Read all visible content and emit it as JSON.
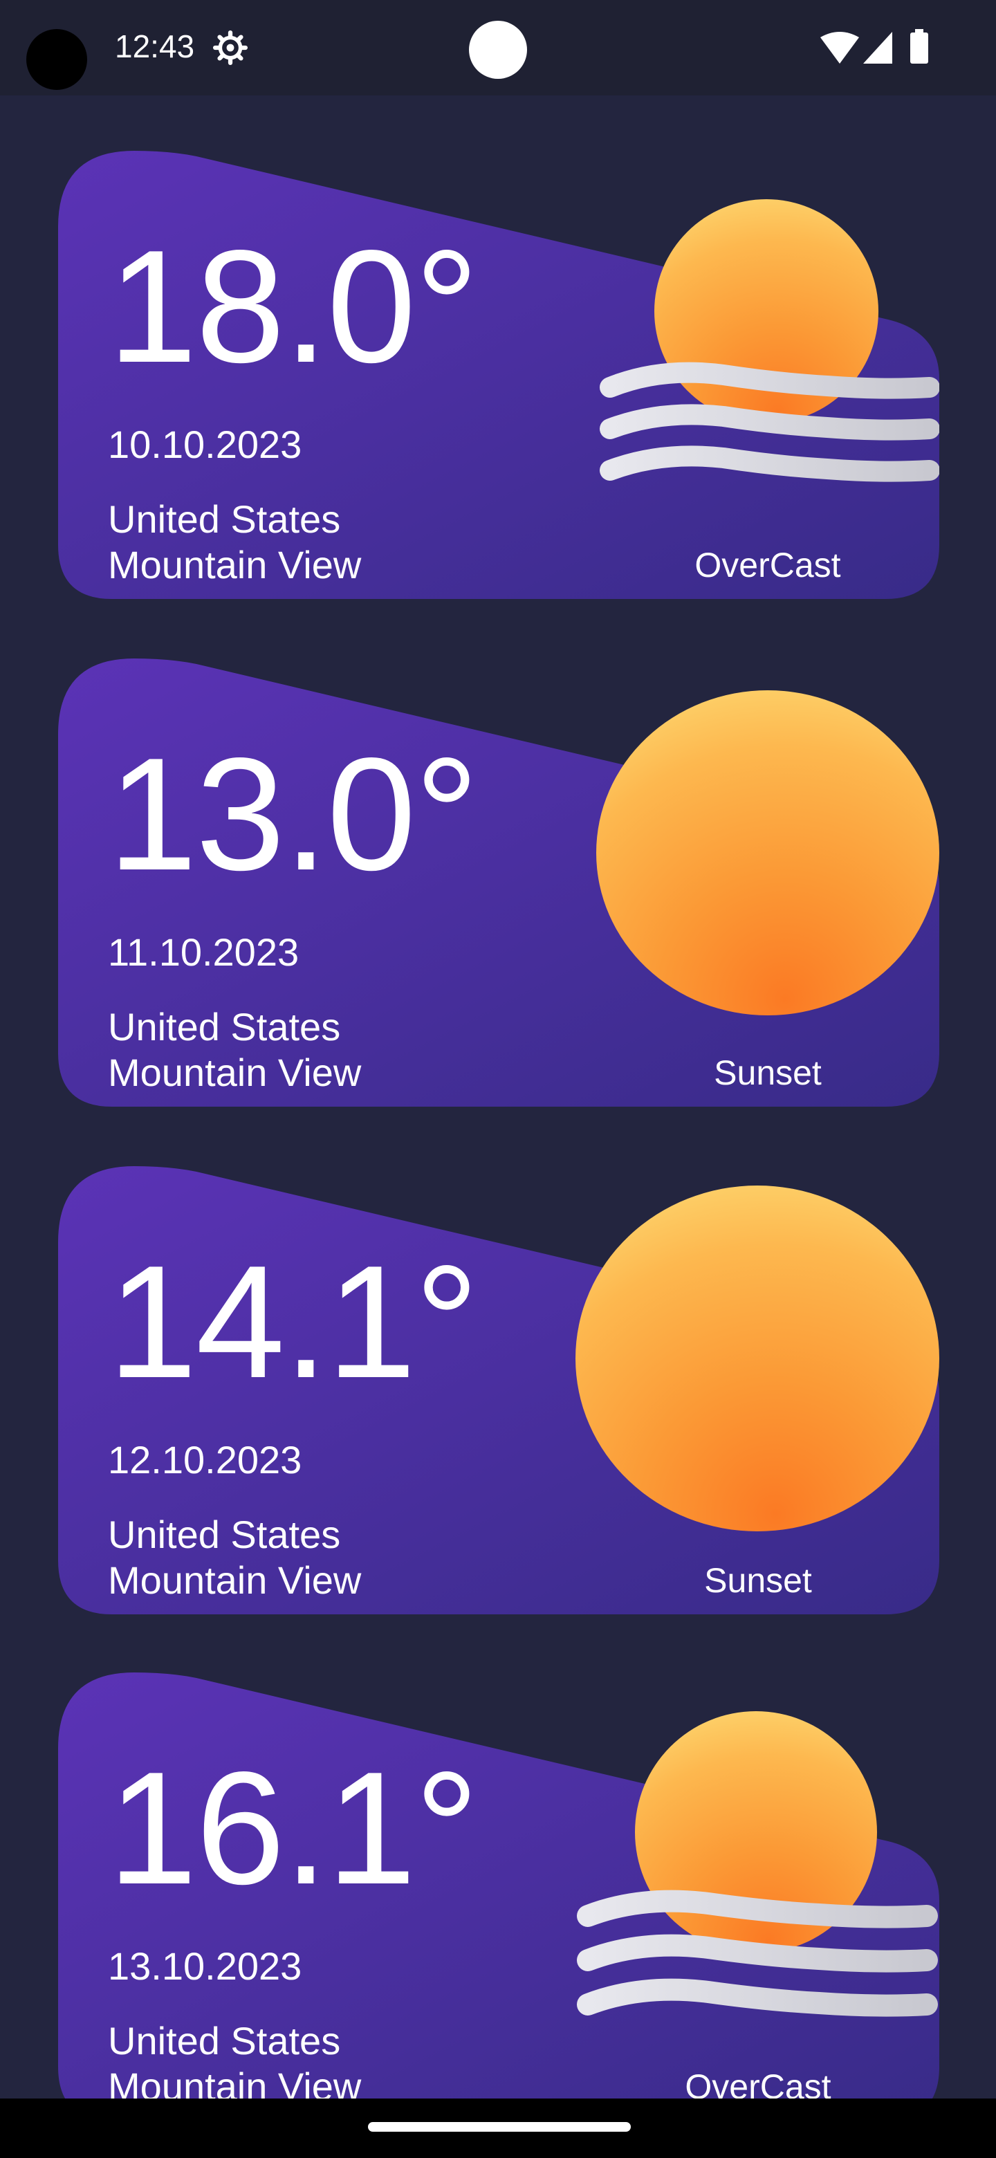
{
  "status_bar": {
    "time": "12:43",
    "icons": [
      "settings-icon",
      "wifi-icon",
      "cellular-icon",
      "battery-icon"
    ]
  },
  "colors": {
    "background": "#23253f",
    "card_gradient_start": "#5a32b4",
    "card_gradient_end": "#3a2c8c",
    "sun_core": "#fb7a24",
    "sun_edge": "#fde07a"
  },
  "forecasts": [
    {
      "temperature": "18.0°",
      "date": "10.10.2023",
      "country": "United States",
      "city": "Mountain View",
      "condition": "OverCast",
      "icon": "overcast-sun-icon"
    },
    {
      "temperature": "13.0°",
      "date": "11.10.2023",
      "country": "United States",
      "city": "Mountain View",
      "condition": "Sunset",
      "icon": "sun-icon"
    },
    {
      "temperature": "14.1°",
      "date": "12.10.2023",
      "country": "United States",
      "city": "Mountain View",
      "condition": "Sunset",
      "icon": "sun-icon"
    },
    {
      "temperature": "16.1°",
      "date": "13.10.2023",
      "country": "United States",
      "city": "Mountain View",
      "condition": "OverCast",
      "icon": "overcast-sun-icon"
    }
  ]
}
